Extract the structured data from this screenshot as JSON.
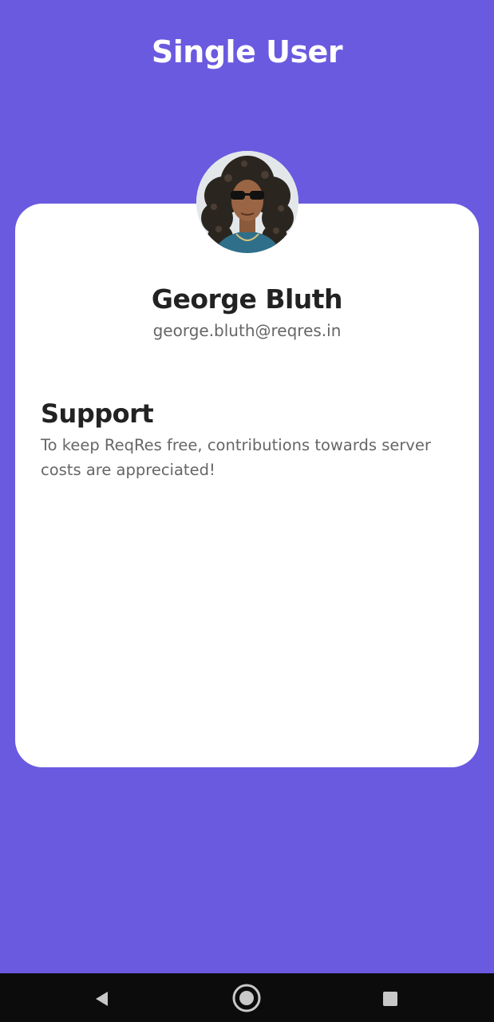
{
  "header": {
    "title": "Single User"
  },
  "user": {
    "name": "George Bluth",
    "email": "george.bluth@reqres.in",
    "avatar_icon": "user-avatar-photo"
  },
  "support": {
    "heading": "Support",
    "text": "To keep ReqRes free, contributions towards server costs are appreciated!"
  },
  "navigation": {
    "back_icon": "back-triangle-icon",
    "home_icon": "home-circle-icon",
    "recents_icon": "recents-square-icon"
  },
  "colors": {
    "background": "#6a5ae0",
    "card": "#ffffff",
    "title_text": "#ffffff",
    "primary_text": "#222222",
    "secondary_text": "#666666",
    "nav_bar": "#0c0c0c"
  }
}
